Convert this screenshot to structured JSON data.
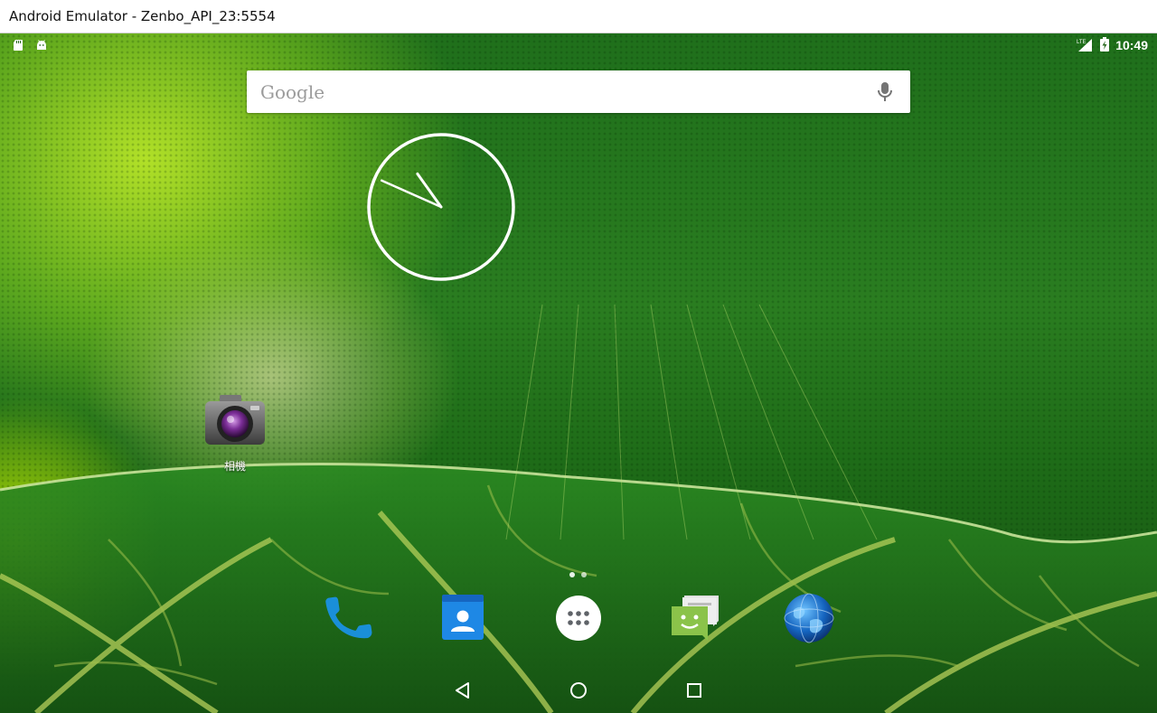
{
  "window": {
    "title": "Android Emulator - Zenbo_API_23:5554"
  },
  "status_bar": {
    "left_icons": [
      "sd-card-icon",
      "android-debug-icon"
    ],
    "right_icons": [
      "lte-signal-icon",
      "battery-charging-icon"
    ],
    "lte_label": "LTE",
    "time": "10:49"
  },
  "search": {
    "placeholder": "Google",
    "icon": "mic-icon"
  },
  "clock": {
    "hour": 10,
    "minute": 49
  },
  "desktop_apps": [
    {
      "label": "相機",
      "icon": "camera-icon"
    }
  ],
  "page_indicator": {
    "pages": 2,
    "current": 0
  },
  "dock": [
    {
      "name": "phone",
      "icon": "phone-icon"
    },
    {
      "name": "contacts",
      "icon": "contacts-icon"
    },
    {
      "name": "all-apps",
      "icon": "app-drawer-icon"
    },
    {
      "name": "messaging",
      "icon": "messaging-icon"
    },
    {
      "name": "browser",
      "icon": "globe-icon"
    }
  ],
  "nav_bar": [
    "back-icon",
    "home-icon",
    "recents-icon"
  ],
  "colors": {
    "wallpaper_green": "#1f6f1b",
    "accent_lime": "#b9e628",
    "search_bg": "#ffffff"
  }
}
